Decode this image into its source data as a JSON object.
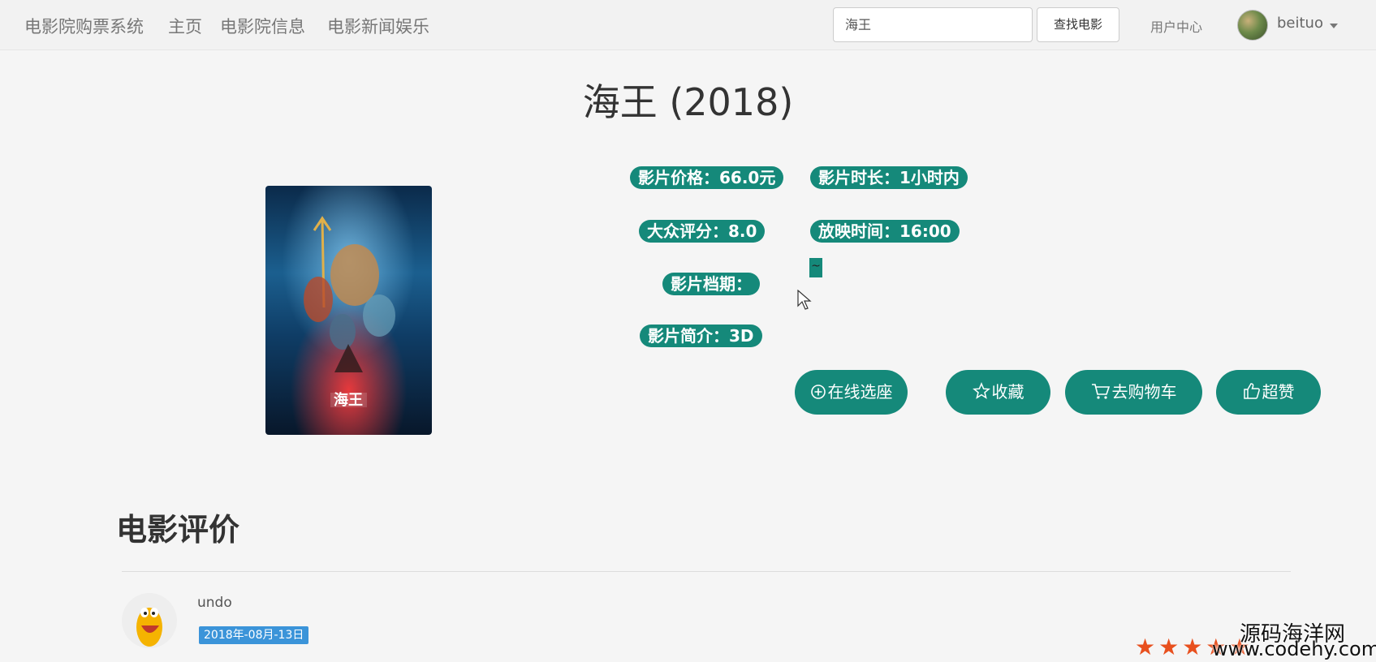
{
  "navbar": {
    "brand": "电影院购票系统",
    "links": [
      "主页",
      "电影院信息",
      "电影新闻娱乐"
    ],
    "search_value": "海王",
    "search_button": "查找电影",
    "user_center": "用户中心",
    "username": "beituo"
  },
  "movie": {
    "title": "海王 (2018)",
    "price_label": "影片价格：66.0元",
    "duration_label": "影片时长：1小时内",
    "rating_label": "大众评分：8.0",
    "showtime_label": "放映时间：16:00",
    "schedule_label": "影片档期：",
    "schedule_value": "~",
    "intro_label": "影片简介：3D"
  },
  "actions": {
    "seat": "在线选座",
    "favorite": "收藏",
    "cart": "去购物车",
    "like": "超赞"
  },
  "reviews": {
    "title": "电影评价",
    "items": [
      {
        "user": "undo",
        "date": "2018年-08月-13日",
        "stars": "★★★★★"
      }
    ]
  },
  "watermark": {
    "cn": "源码海洋网",
    "url": "www.codehy.com"
  },
  "colors": {
    "accent": "#15897a",
    "date_badge": "#3b94d9",
    "star": "#e8501e"
  }
}
